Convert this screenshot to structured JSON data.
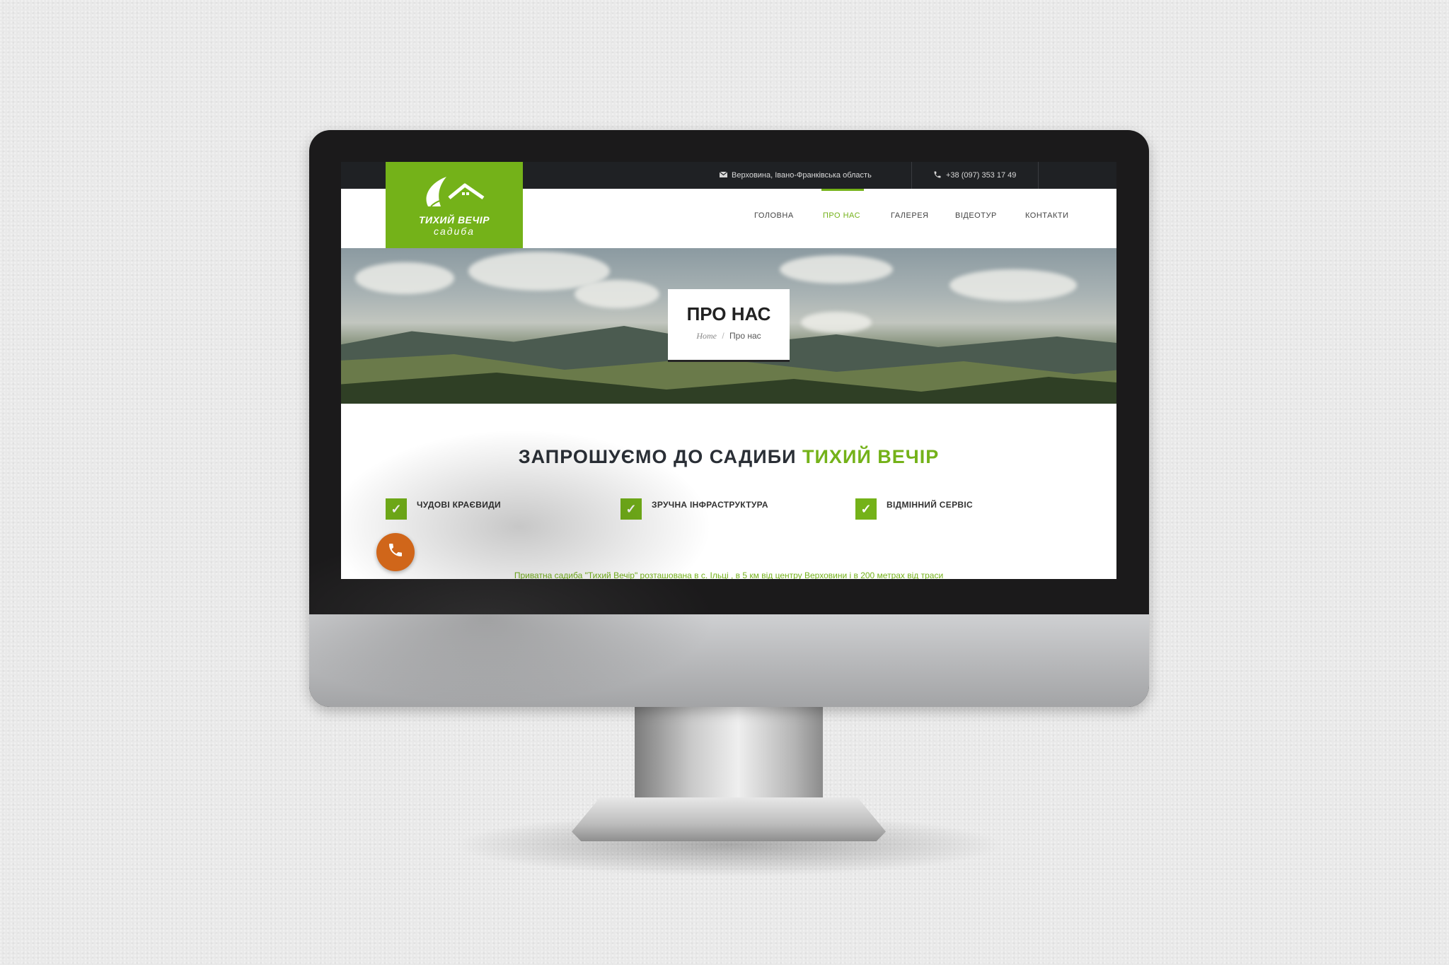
{
  "topbar": {
    "address": "Верховина, Івано-Франківська область",
    "phone": "+38 (097) 353 17 49"
  },
  "logo": {
    "name": "ТИХИЙ ВЕЧІР",
    "sub": "садиба"
  },
  "nav": {
    "items": [
      {
        "label": "ГОЛОВНА"
      },
      {
        "label": "ПРО НАС"
      },
      {
        "label": "ГАЛЕРЕЯ"
      },
      {
        "label": "ВІДЕОТУР"
      },
      {
        "label": "КОНТАКТИ"
      }
    ],
    "active_index": 1
  },
  "hero": {
    "title": "ПРО НАС",
    "breadcrumb_home": "Home",
    "breadcrumb_sep": "/",
    "breadcrumb_current": "Про нас"
  },
  "section": {
    "title_part1": "ЗАПРОШУЄМО ДО САДИБИ",
    "title_part2": "ТИХИЙ ВЕЧІР"
  },
  "features": [
    {
      "label": "ЧУДОВІ КРАЄВИДИ"
    },
    {
      "label": "ЗРУЧНА ІНФРАСТРУКТУРА"
    },
    {
      "label": "ВІДМІННИЙ СЕРВІС"
    }
  ],
  "intro_text": "Приватна садиба \"Тихий Вечір\" розташована в с. Ільці , в 5 км від центру Верховини і в 200 метрах від траси",
  "icons": {
    "mail": "mail-icon",
    "phone": "phone-icon",
    "check": "check-icon",
    "call": "phone-call-icon"
  },
  "colors": {
    "brand_green": "#74b219",
    "topbar": "#1f2124",
    "call_button": "#d0661a"
  }
}
